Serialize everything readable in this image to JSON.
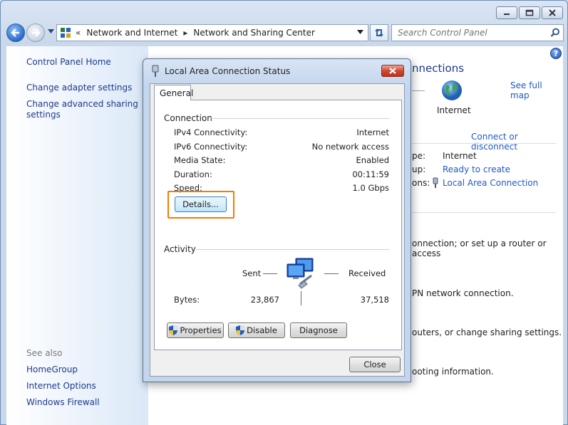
{
  "window": {
    "controls": [
      "minimize",
      "maximize",
      "close"
    ]
  },
  "navbar": {
    "breadcrumbs": [
      "Network and Internet",
      "Network and Sharing Center"
    ],
    "chevrons": "«",
    "separator": "▸",
    "search_placeholder": "Search Control Panel"
  },
  "leftpane": {
    "home": "Control Panel Home",
    "links": [
      "Change adapter settings",
      "Change advanced sharing settings"
    ],
    "see_also_label": "See also",
    "see_also": [
      "HomeGroup",
      "Internet Options",
      "Windows Firewall"
    ]
  },
  "main": {
    "heading_partial": "nnections",
    "see_full_map": "See full map",
    "internet_label": "Internet",
    "connect_disconnect": "Connect or disconnect",
    "access_type_label": "pe:",
    "access_type_value": "Internet",
    "homegroup_label": "up:",
    "homegroup_value": "Ready to create",
    "connections_label": "ons:",
    "connections_value": "Local Area Connection",
    "line1": "onnection; or set up a router or access",
    "line2": "PN network connection.",
    "line3": "outers, or change sharing settings.",
    "line4": "ooting information."
  },
  "dialog": {
    "title": "Local Area Connection Status",
    "tab": "General",
    "connection_group": "Connection",
    "rows": [
      {
        "label": "IPv4 Connectivity:",
        "value": "Internet"
      },
      {
        "label": "IPv6 Connectivity:",
        "value": "No network access"
      },
      {
        "label": "Media State:",
        "value": "Enabled"
      },
      {
        "label": "Duration:",
        "value": "00:11:59"
      },
      {
        "label": "Speed:",
        "value": "1.0 Gbps"
      }
    ],
    "details_button": "Details...",
    "activity_group": "Activity",
    "sent_label": "Sent",
    "received_label": "Received",
    "bytes_label": "Bytes:",
    "bytes_sent": "23,867",
    "bytes_received": "37,518",
    "properties_button": "Properties",
    "disable_button": "Disable",
    "diagnose_button": "Diagnose",
    "close_button": "Close"
  }
}
